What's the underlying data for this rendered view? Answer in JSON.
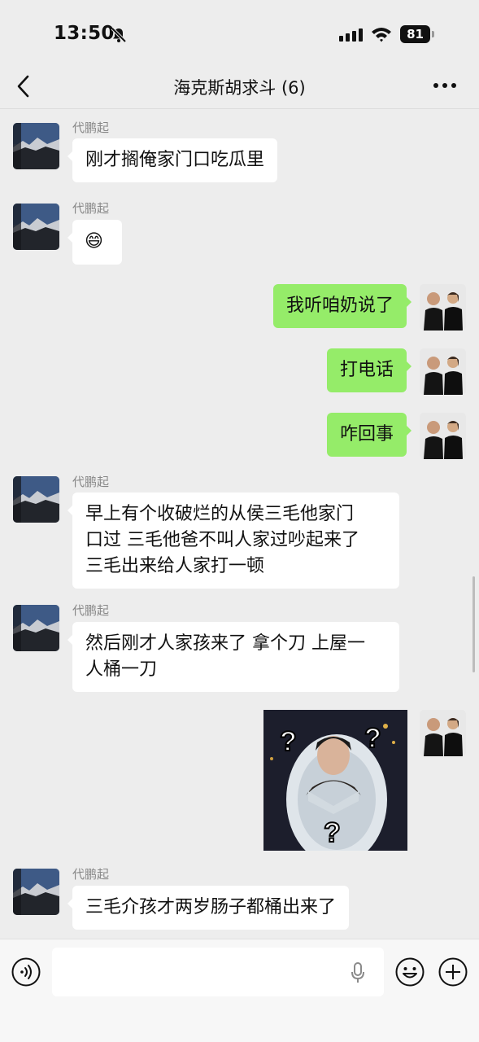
{
  "status_bar": {
    "time": "13:50",
    "battery": "81"
  },
  "header": {
    "title": "海克斯胡求斗 (6)"
  },
  "messages": [
    {
      "sender": "代鹏起",
      "text": "刚才搁俺家门口吃瓜里"
    },
    {
      "sender": "代鹏起",
      "emoji": "😄"
    },
    {
      "text": "我听咱奶说了"
    },
    {
      "text": "打电话"
    },
    {
      "text": "咋回事"
    },
    {
      "sender": "代鹏起",
      "lines": [
        "早上有个收破烂的从侯三毛他家门",
        "口过 三毛他爸不叫人家过吵起来了",
        "三毛出来给人家打一顿"
      ]
    },
    {
      "sender": "代鹏起",
      "lines": [
        "然后刚才人家孩来了 拿个刀 上屋一",
        "人桶一刀"
      ]
    },
    {
      "sticker": "question-mark-egg-sticker"
    },
    {
      "sender": "代鹏起",
      "text": "三毛介孩才两岁肠子都桶出来了"
    }
  ],
  "colors": {
    "outgoing_bubble": "#95ec69",
    "incoming_bubble": "#ffffff",
    "background": "#ededed"
  },
  "icons": [
    "mute-bell-icon",
    "signal-icon",
    "wifi-icon",
    "back-icon",
    "more-icon",
    "voice-toggle-icon",
    "microphone-icon",
    "emoji-icon",
    "plus-icon"
  ]
}
